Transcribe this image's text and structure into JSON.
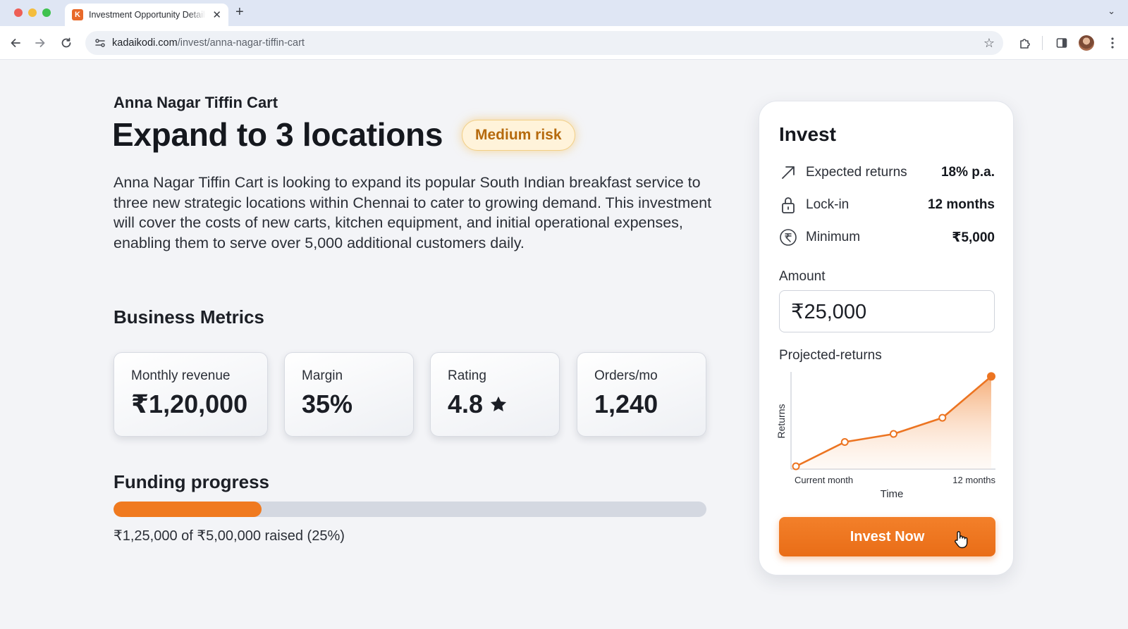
{
  "browser": {
    "tab_title": "Investment Opportunity Details",
    "favicon_letter": "K",
    "url_host": "kadaikodi.com",
    "url_path": "/invest/anna-nagar-tiffin-cart",
    "traffic_light_colors": [
      "#ee5f56",
      "#f4bd3d",
      "#3fc24f"
    ]
  },
  "header": {
    "business_name": "Anna Nagar Tiffin Cart",
    "headline": "Expand to 3 locations",
    "risk_badge": "Medium risk"
  },
  "description": "Anna Nagar Tiffin Cart is looking to expand its popular South Indian breakfast service to three new strategic locations within Chennai to cater to growing demand. This investment will cover the costs of new carts, kitchen equipment, and initial operational expenses, enabling them to serve over 5,000 additional customers daily.",
  "metrics": {
    "title": "Business Metrics",
    "items": [
      {
        "label": "Monthly revenue",
        "value": "₹1,20,000"
      },
      {
        "label": "Margin",
        "value": "35%"
      },
      {
        "label": "Rating",
        "value": "4.8",
        "icon": "star-icon"
      },
      {
        "label": "Orders/mo",
        "value": "1,240"
      }
    ]
  },
  "funding": {
    "title": "Funding progress",
    "percent": 25,
    "text": "₹1,25,000 of ₹5,00,000 raised (25%)"
  },
  "invest_card": {
    "title": "Invest",
    "rows": [
      {
        "label": "Expected returns",
        "value": "18% p.a.",
        "icon": "trend-arrow-icon"
      },
      {
        "label": "Lock-in",
        "value": "12 months",
        "icon": "lock-icon"
      },
      {
        "label": "Minimum",
        "value": "₹5,000",
        "icon": "rupee-icon"
      }
    ],
    "amount_label": "Amount",
    "amount_value": "₹25,000",
    "projected_label": "Projected-returns",
    "button_label": "Invest Now"
  },
  "chart_data": {
    "type": "area",
    "x": [
      "Current month",
      "",
      "",
      "",
      "12 months"
    ],
    "values": [
      0,
      0.27,
      0.36,
      0.54,
      1.0
    ],
    "xlabel": "Time",
    "ylabel": "Returns",
    "tick_labels": [
      "Current month",
      "12 months"
    ],
    "ylim": [
      0,
      1.05
    ],
    "grid": false,
    "legend": "none",
    "color": "#ec7421"
  },
  "colors": {
    "accent": "#f07a1f",
    "risk_text": "#b66a0d",
    "risk_bg": "#fff3da"
  }
}
